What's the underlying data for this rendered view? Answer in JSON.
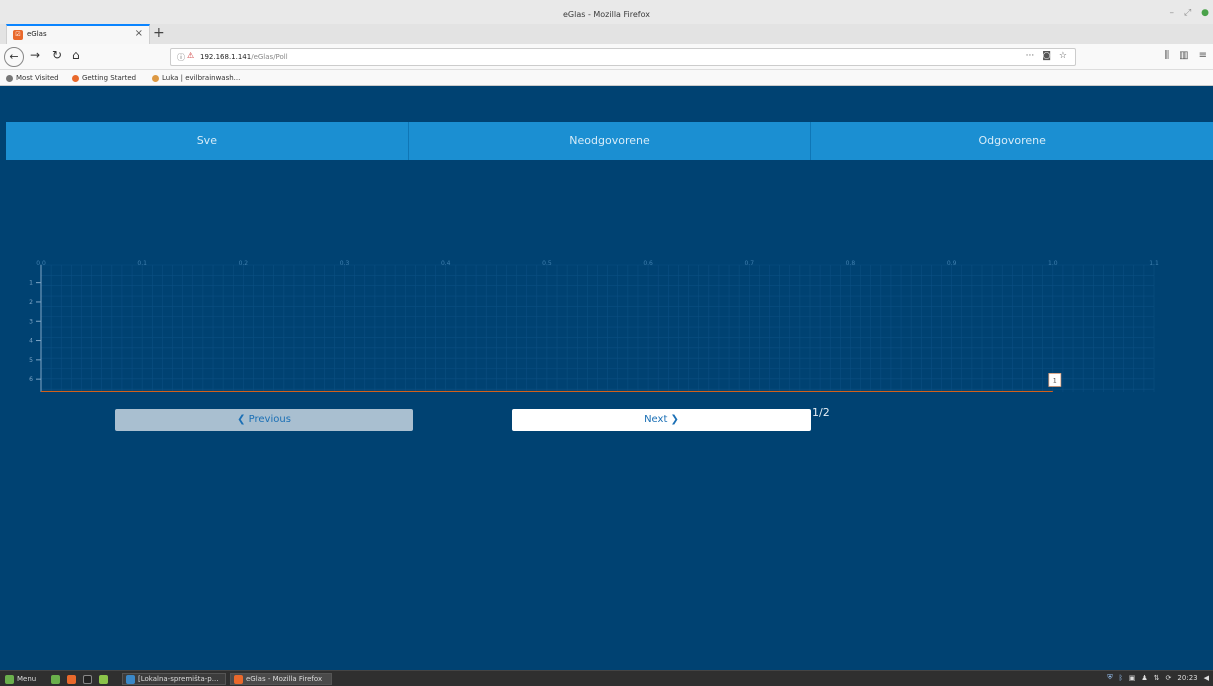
{
  "browser": {
    "window_title": "eGlas - Mozilla Firefox",
    "tab_title": "eGlas",
    "url_host": "192.168.1.141",
    "url_path": "/eGlas/Poll",
    "bookmarks": [
      "Most Visited",
      "Getting Started",
      "Luka | evilbrainwash..."
    ]
  },
  "page": {
    "tabs": [
      "Sve",
      "Neodgovorene",
      "Odgovorene"
    ],
    "prev_label": "Previous",
    "next_label": "Next",
    "pager": "1/2"
  },
  "chart_data": {
    "type": "bar",
    "orientation": "horizontal",
    "x_ticks": [
      "0.0",
      "0.1",
      "0.2",
      "0.3",
      "0.4",
      "0.5",
      "0.6",
      "0.7",
      "0.8",
      "0.9",
      "1.0",
      "1.1"
    ],
    "xlim": [
      0,
      1.1
    ],
    "y_ticks": [
      "1",
      "2",
      "3",
      "4",
      "5",
      "6",
      "7",
      "8",
      "9",
      "10"
    ],
    "categories": [
      "1",
      "2",
      "3",
      "4",
      "5",
      "6",
      "7",
      "8",
      "9",
      "10"
    ],
    "values": [
      0,
      0,
      0,
      0,
      0,
      0,
      1,
      0,
      0,
      0
    ],
    "data_labels": [
      {
        "category": "7",
        "label": "1"
      }
    ],
    "bar_color": "#d2601a",
    "grid": true
  },
  "taskbar": {
    "menu_label": "Menu",
    "tasks": [
      "[Lokalna-spremišta-p...",
      "eGlas - Mozilla Firefox"
    ],
    "clock": "20:23"
  },
  "colors": {
    "page_bg": "#004272",
    "tab_bg": "#1b8fd2",
    "bar": "#d2601a"
  }
}
